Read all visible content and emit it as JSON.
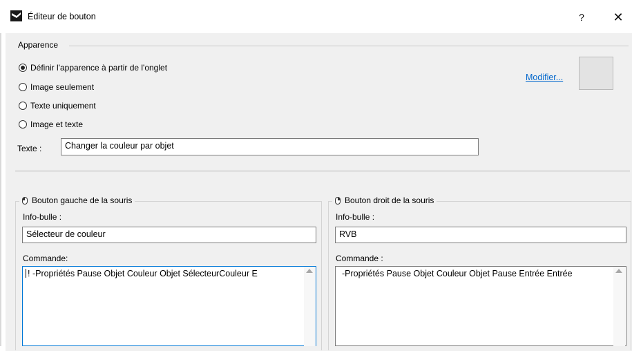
{
  "window": {
    "title": "Éditeur de bouton",
    "help_label": "?",
    "close_label": "✕"
  },
  "appearance": {
    "group_title": "Apparence",
    "options": [
      {
        "label": "Définir l'apparence à partir de l'onglet",
        "selected": true
      },
      {
        "label": "Image seulement",
        "selected": false
      },
      {
        "label": "Texte uniquement",
        "selected": false
      },
      {
        "label": "Image et texte",
        "selected": false
      }
    ],
    "modify_link": "Modifier...",
    "text_label": "Texte :",
    "text_value": "Changer la couleur par objet"
  },
  "left_button": {
    "title": "Bouton gauche de la souris",
    "tooltip_label": "Info-bulle :",
    "tooltip_value": "Sélecteur de couleur",
    "command_label": "Commande:",
    "command_value": "! -Propriétés Pause Objet Couleur Objet SélecteurCouleur E"
  },
  "right_button": {
    "title": "Bouton droit de la souris",
    "tooltip_label": "Info-bulle :",
    "tooltip_value": "RVB",
    "command_label": "Commande :",
    "command_value": "-Propriétés Pause Objet Couleur Objet Pause Entrée Entrée"
  }
}
